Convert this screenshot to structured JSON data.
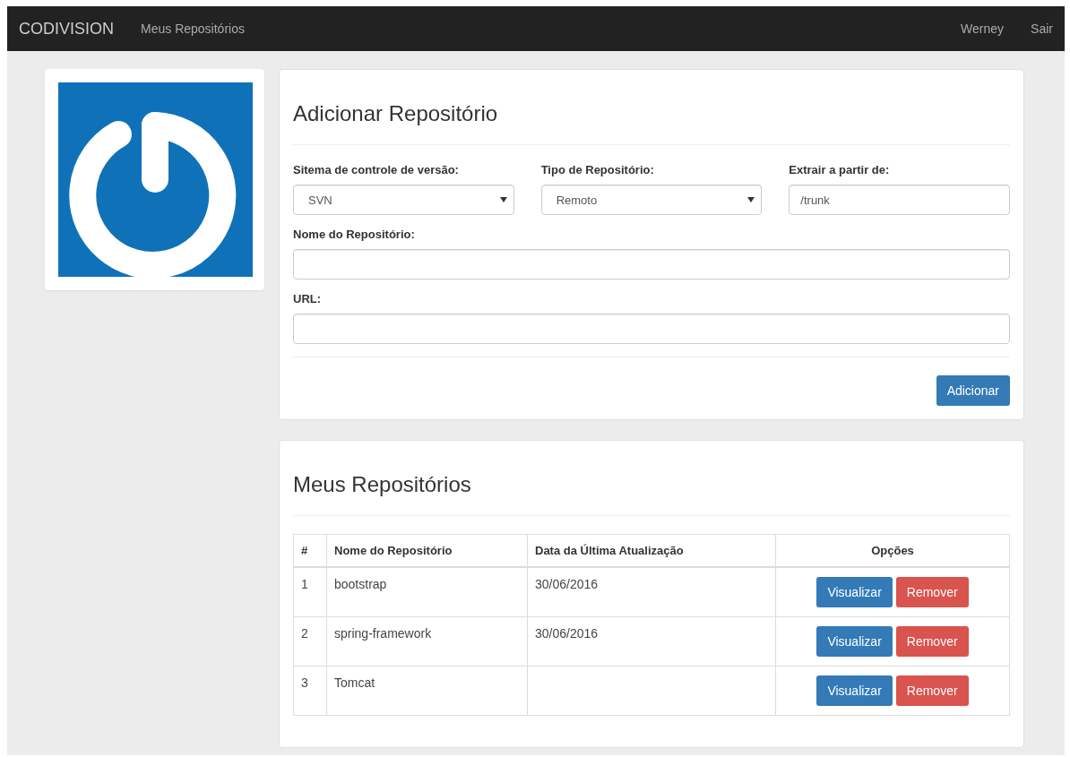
{
  "navbar": {
    "brand": "CODIVISION",
    "links": [
      "Meus Repositórios"
    ],
    "right_links": [
      "Werney",
      "Sair"
    ]
  },
  "add_form": {
    "title": "Adicionar Repositório",
    "fields": [
      {
        "kind": "select",
        "label": "Sitema de controle de versão:",
        "value": "SVN"
      },
      {
        "kind": "select",
        "label": "Tipo de Repositório:",
        "value": "Remoto"
      },
      {
        "kind": "input",
        "label": "Extrair a partir de:",
        "value": "/trunk"
      },
      {
        "kind": "input",
        "label": "Nome do Repositório:"
      },
      {
        "kind": "input",
        "label": "URL:"
      }
    ],
    "submit": "Adicionar"
  },
  "repositories": {
    "title": "Meus Repositórios",
    "columns": [
      "#",
      "Nome do Repositório",
      "Data da Última Atualização",
      "Opções"
    ],
    "rows": [
      {
        "index": "1",
        "name": "bootstrap",
        "updated": "30/06/2016",
        "actions": [
          "Visualizar",
          "Remover"
        ]
      },
      {
        "index": "2",
        "name": "spring-framework",
        "updated": "30/06/2016",
        "actions": [
          "Visualizar",
          "Remover"
        ]
      },
      {
        "index": "3",
        "name": "Tomcat",
        "actions": [
          "Visualizar",
          "Remover"
        ]
      }
    ]
  }
}
